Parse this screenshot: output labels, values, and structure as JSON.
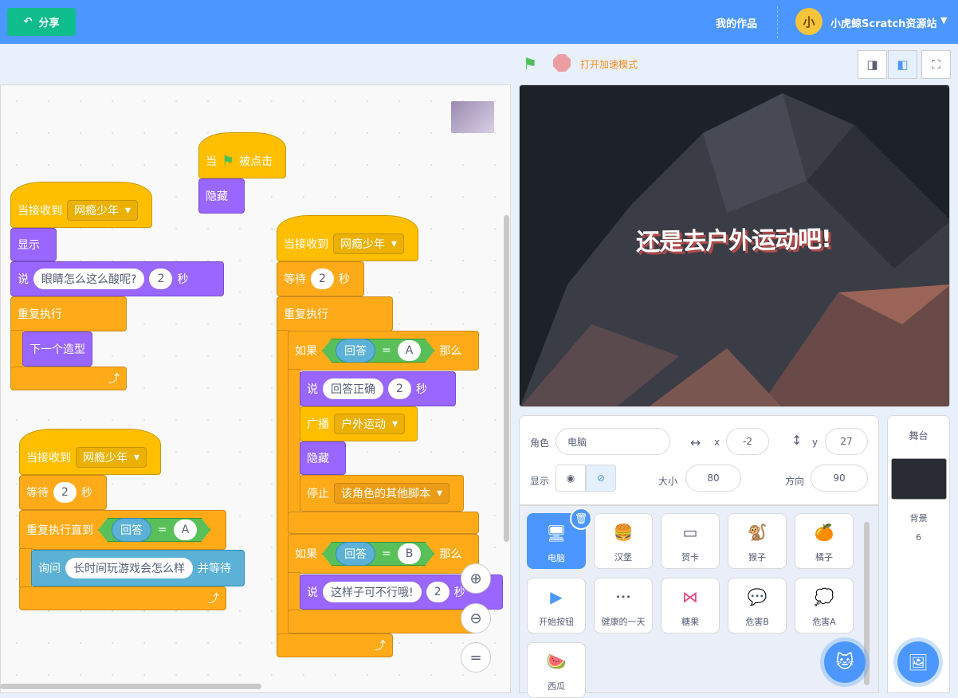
{
  "menubar": {
    "share": "分享",
    "my_works": "我的作品",
    "avatar_text": "小",
    "user": "小虎鲸Scratch资源站"
  },
  "controls": {
    "turbo": "打开加速模式"
  },
  "stage": {
    "text": "还是去户外运动吧!"
  },
  "blocks": {
    "when": "当",
    "clicked": "被点击",
    "hide": "隐藏",
    "when_receive": "当接收到",
    "msg": "网瘾少年",
    "show": "显示",
    "say": "说",
    "say1": "眼睛怎么这么酸呢?",
    "secs": "秒",
    "two": "2",
    "forever": "重复执行",
    "next_costume": "下一个造型",
    "wait": "等待",
    "repeat_until": "重复执行直到",
    "answer": "回答",
    "eq": "=",
    "A": "A",
    "B": "B",
    "ask": "询问",
    "ask_q": "长时间玩游戏会怎么样",
    "and_wait": "并等待",
    "if": "如果",
    "then": "那么",
    "correct": "回答正确",
    "broadcast": "广播",
    "outdoor": "户外运动",
    "stop": "停止",
    "stop_opt": "该角色的其他脚本",
    "wrong": "这样子可不行哦!"
  },
  "sprite_info": {
    "sprite_label": "角色",
    "name": "电脑",
    "x_label": "x",
    "x": "-2",
    "y_label": "y",
    "y": "27",
    "show_label": "显示",
    "size_label": "大小",
    "size": "80",
    "dir_label": "方向",
    "dir": "90"
  },
  "sprites": [
    "电脑",
    "汉堡",
    "贺卡",
    "猴子",
    "橘子",
    "开始按钮",
    "健康的一天",
    "糖果",
    "危害B",
    "危害A",
    "西瓜"
  ],
  "stage_pane": {
    "title": "舞台",
    "backdrop_label": "背景",
    "count": "6"
  },
  "colors": {
    "menubar": "#4c97ff",
    "events": "#ffbf00",
    "looks": "#9966ff",
    "control": "#ffab19",
    "sensing": "#5cb1d6",
    "operators": "#59c059"
  }
}
